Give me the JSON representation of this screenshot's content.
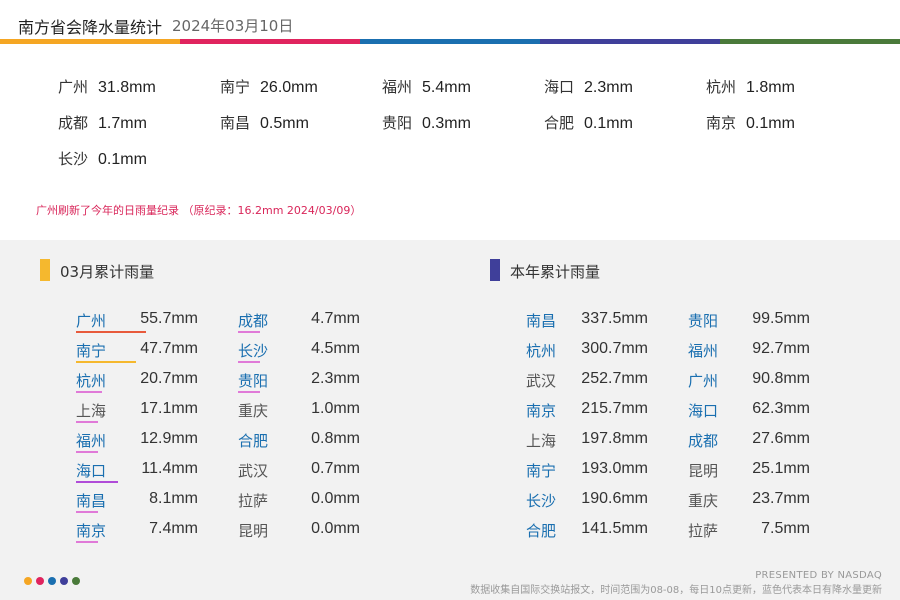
{
  "header": {
    "title": "南方省会降水量统计",
    "date": "2024年03月10日",
    "colors": [
      "#f5a623",
      "#e0245e",
      "#1a6fb0",
      "#3f3f9a",
      "#4a7a3a"
    ]
  },
  "daily": [
    {
      "city": "广州",
      "value": "31.8mm"
    },
    {
      "city": "南宁",
      "value": "26.0mm"
    },
    {
      "city": "福州",
      "value": "5.4mm"
    },
    {
      "city": "海口",
      "value": "2.3mm"
    },
    {
      "city": "杭州",
      "value": "1.8mm"
    },
    {
      "city": "成都",
      "value": "1.7mm"
    },
    {
      "city": "南昌",
      "value": "0.5mm"
    },
    {
      "city": "贵阳",
      "value": "0.3mm"
    },
    {
      "city": "合肥",
      "value": "0.1mm"
    },
    {
      "city": "南京",
      "value": "0.1mm"
    },
    {
      "city": "长沙",
      "value": "0.1mm"
    }
  ],
  "record_note": "广州刷新了今年的日雨量纪录 （原纪录：16.2mm 2024/03/09）",
  "monthly": {
    "title": "03月累计雨量",
    "accent": "#f5b82e",
    "rows": [
      {
        "city": "广州",
        "value": "55.7mm",
        "blue": true,
        "underline": "#e85a3c",
        "ratio": 1.0
      },
      {
        "city": "南宁",
        "value": "47.7mm",
        "blue": true,
        "underline": "#f5b82e",
        "ratio": 0.86
      },
      {
        "city": "杭州",
        "value": "20.7mm",
        "blue": true,
        "underline": "#e07ad8",
        "ratio": 0.37
      },
      {
        "city": "上海",
        "value": "17.1mm",
        "blue": false,
        "underline": "#e07ad8",
        "ratio": 0.31
      },
      {
        "city": "福州",
        "value": "12.9mm",
        "blue": true,
        "underline": "#e07ad8",
        "ratio": 0.23
      },
      {
        "city": "海口",
        "value": "11.4mm",
        "blue": true,
        "underline": "#b04cd8",
        "ratio": 0.6
      },
      {
        "city": "南昌",
        "value": "8.1mm",
        "blue": true,
        "underline": "#e07ad8",
        "ratio": 0.15
      },
      {
        "city": "南京",
        "value": "7.4mm",
        "blue": true,
        "underline": "#e07ad8",
        "ratio": 0.13
      },
      {
        "city": "成都",
        "value": "4.7mm",
        "blue": true,
        "underline": "#e07ad8",
        "ratio": 0.08
      },
      {
        "city": "长沙",
        "value": "4.5mm",
        "blue": true,
        "underline": "#e07ad8",
        "ratio": 0.08
      },
      {
        "city": "贵阳",
        "value": "2.3mm",
        "blue": true,
        "underline": "#e07ad8",
        "ratio": 0.04
      },
      {
        "city": "重庆",
        "value": "1.0mm",
        "blue": false,
        "underline": "",
        "ratio": 0
      },
      {
        "city": "合肥",
        "value": "0.8mm",
        "blue": true,
        "underline": "",
        "ratio": 0
      },
      {
        "city": "武汉",
        "value": "0.7mm",
        "blue": false,
        "underline": "",
        "ratio": 0
      },
      {
        "city": "拉萨",
        "value": "0.0mm",
        "blue": false,
        "underline": "",
        "ratio": 0
      },
      {
        "city": "昆明",
        "value": "0.0mm",
        "blue": false,
        "underline": "",
        "ratio": 0
      }
    ]
  },
  "yearly": {
    "title": "本年累计雨量",
    "accent": "#3f3f9a",
    "rows": [
      {
        "city": "南昌",
        "value": "337.5mm",
        "blue": true
      },
      {
        "city": "杭州",
        "value": "300.7mm",
        "blue": true
      },
      {
        "city": "武汉",
        "value": "252.7mm",
        "blue": false
      },
      {
        "city": "南京",
        "value": "215.7mm",
        "blue": true
      },
      {
        "city": "上海",
        "value": "197.8mm",
        "blue": false
      },
      {
        "city": "南宁",
        "value": "193.0mm",
        "blue": true
      },
      {
        "city": "长沙",
        "value": "190.6mm",
        "blue": true
      },
      {
        "city": "合肥",
        "value": "141.5mm",
        "blue": true
      },
      {
        "city": "贵阳",
        "value": "99.5mm",
        "blue": true
      },
      {
        "city": "福州",
        "value": "92.7mm",
        "blue": true
      },
      {
        "city": "广州",
        "value": "90.8mm",
        "blue": true
      },
      {
        "city": "海口",
        "value": "62.3mm",
        "blue": true
      },
      {
        "city": "成都",
        "value": "27.6mm",
        "blue": true
      },
      {
        "city": "昆明",
        "value": "25.1mm",
        "blue": false
      },
      {
        "city": "重庆",
        "value": "23.7mm",
        "blue": false
      },
      {
        "city": "拉萨",
        "value": "7.5mm",
        "blue": false
      }
    ]
  },
  "footer": {
    "dot_colors": [
      "#f5a623",
      "#e0245e",
      "#1a6fb0",
      "#3f3f9a",
      "#4a7a3a"
    ],
    "presented": "PRESENTED BY NASDAQ",
    "note": "数据收集自国际交换站报文，时间范围为08-08，每日10点更新，蓝色代表本日有降水量更新"
  }
}
